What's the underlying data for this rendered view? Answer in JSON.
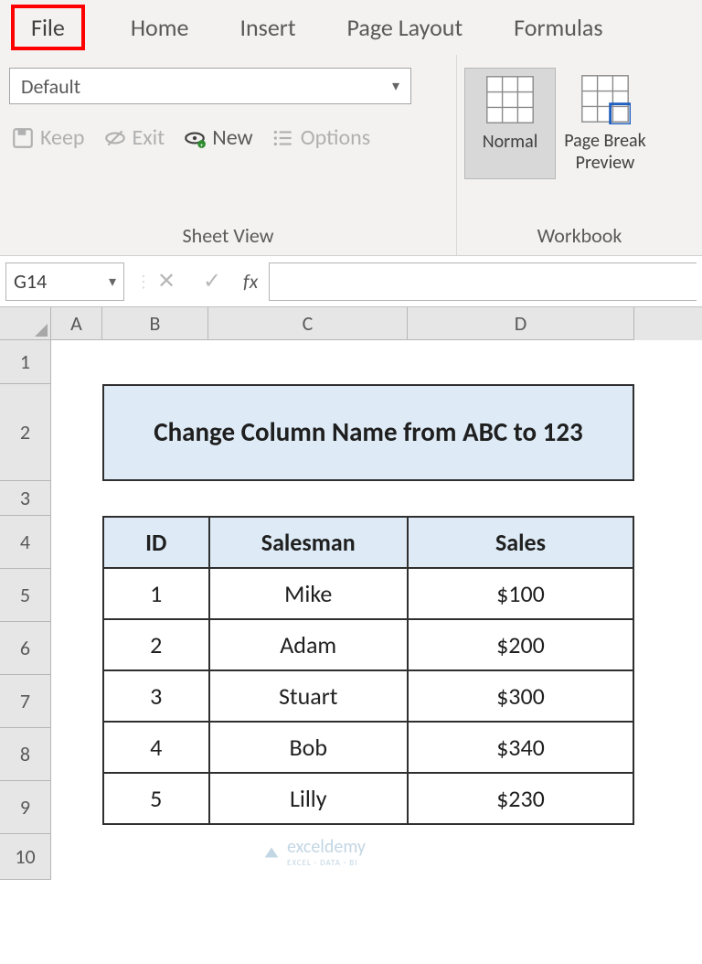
{
  "ribbon": {
    "tabs": [
      "File",
      "Home",
      "Insert",
      "Page Layout",
      "Formulas"
    ],
    "highlighted_tab_index": 0
  },
  "sheetview": {
    "selected": "Default",
    "keep": "Keep",
    "exit": "Exit",
    "new": "New",
    "options": "Options",
    "group_label": "Sheet View"
  },
  "workbook_views": {
    "normal": "Normal",
    "page_break": "Page Break Preview",
    "group_label": "Workbook"
  },
  "formula_bar": {
    "name_box": "G14",
    "fx": "fx",
    "value": ""
  },
  "columns": [
    "A",
    "B",
    "C",
    "D"
  ],
  "rows": [
    "1",
    "2",
    "3",
    "4",
    "5",
    "6",
    "7",
    "8",
    "9",
    "10"
  ],
  "sheet": {
    "title": "Change Column Name from ABC to 123",
    "headers": {
      "id": "ID",
      "salesman": "Salesman",
      "sales": "Sales"
    },
    "data": [
      {
        "id": "1",
        "salesman": "Mike",
        "sales": "$100"
      },
      {
        "id": "2",
        "salesman": "Adam",
        "sales": "$200"
      },
      {
        "id": "3",
        "salesman": "Stuart",
        "sales": "$300"
      },
      {
        "id": "4",
        "salesman": "Bob",
        "sales": "$340"
      },
      {
        "id": "5",
        "salesman": "Lilly",
        "sales": "$230"
      }
    ]
  },
  "watermark": {
    "brand": "exceldemy",
    "tagline": "EXCEL · DATA · BI"
  }
}
